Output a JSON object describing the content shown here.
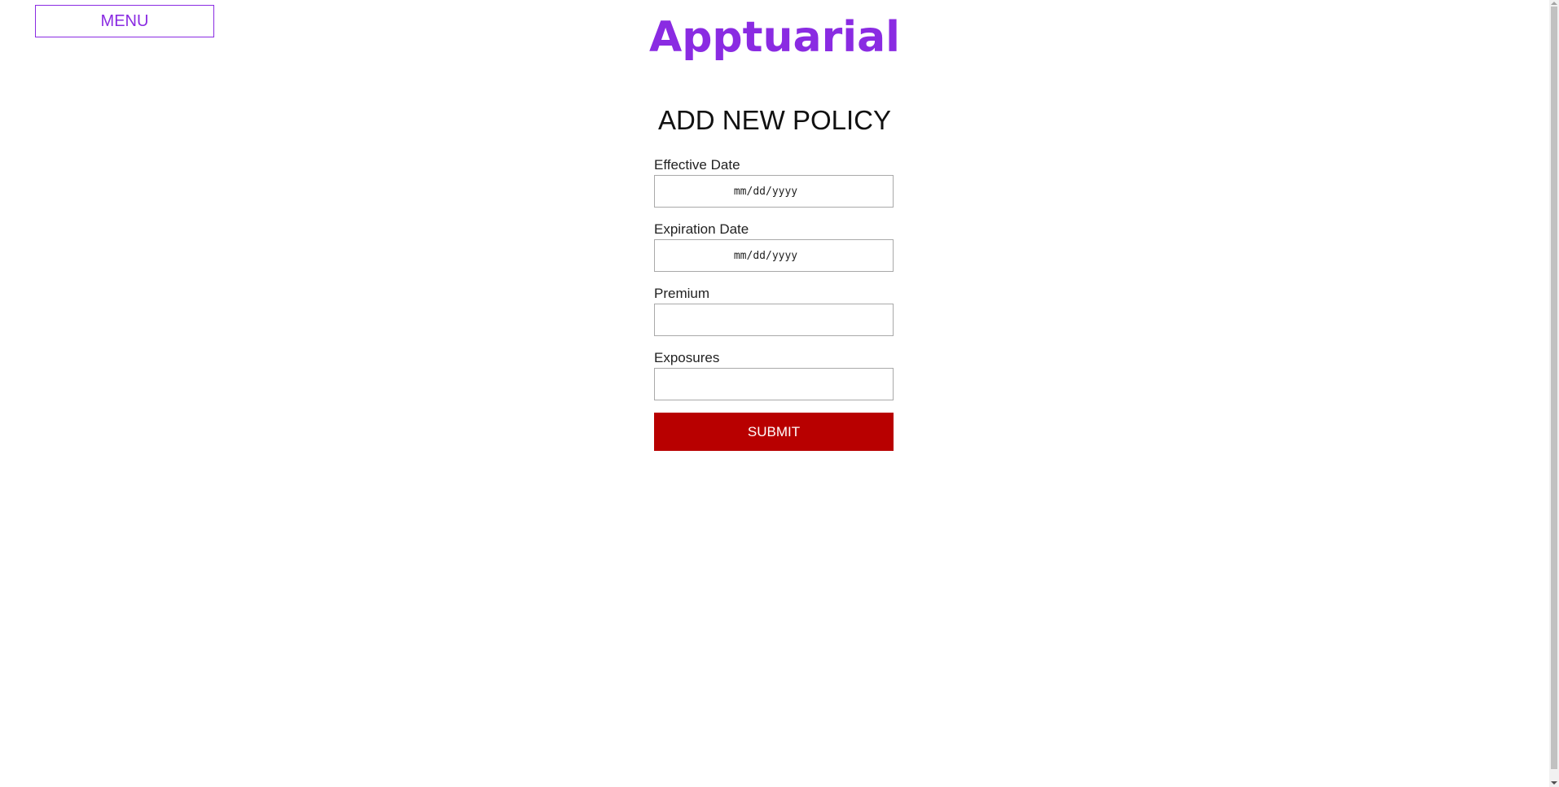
{
  "header": {
    "menu_label": "MENU",
    "brand": "Apptuarial"
  },
  "page_title": "ADD NEW POLICY",
  "form": {
    "fields": [
      {
        "label": "Effective Date",
        "placeholder": "mm/dd/yyyy"
      },
      {
        "label": "Expiration Date",
        "placeholder": "mm/dd/yyyy"
      },
      {
        "label": "Premium",
        "placeholder": ""
      },
      {
        "label": "Exposures",
        "placeholder": ""
      }
    ],
    "submit_label": "SUBMIT"
  },
  "colors": {
    "brand": "#8a2be2",
    "submit": "#b80000"
  }
}
